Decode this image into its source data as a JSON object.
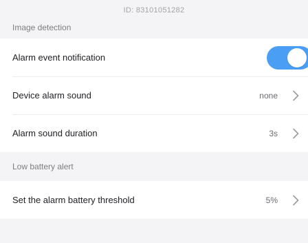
{
  "device": {
    "id_text": "ID:  83101051282"
  },
  "sections": [
    {
      "title": "Image detection",
      "rows": [
        {
          "label": "Alarm event notification",
          "toggle_on": true
        },
        {
          "label": "Device alarm sound",
          "value": "none"
        },
        {
          "label": "Alarm sound duration",
          "value": "3s"
        }
      ]
    },
    {
      "title": "Low battery alert",
      "rows": [
        {
          "label": "Set the alarm battery threshold",
          "value": "5%"
        }
      ]
    }
  ],
  "icons": {
    "row_chevron": "chevron-right-icon"
  },
  "colors": {
    "toggle_on": "#4a9ff5",
    "background": "#f4f4f6",
    "card": "#ffffff"
  }
}
